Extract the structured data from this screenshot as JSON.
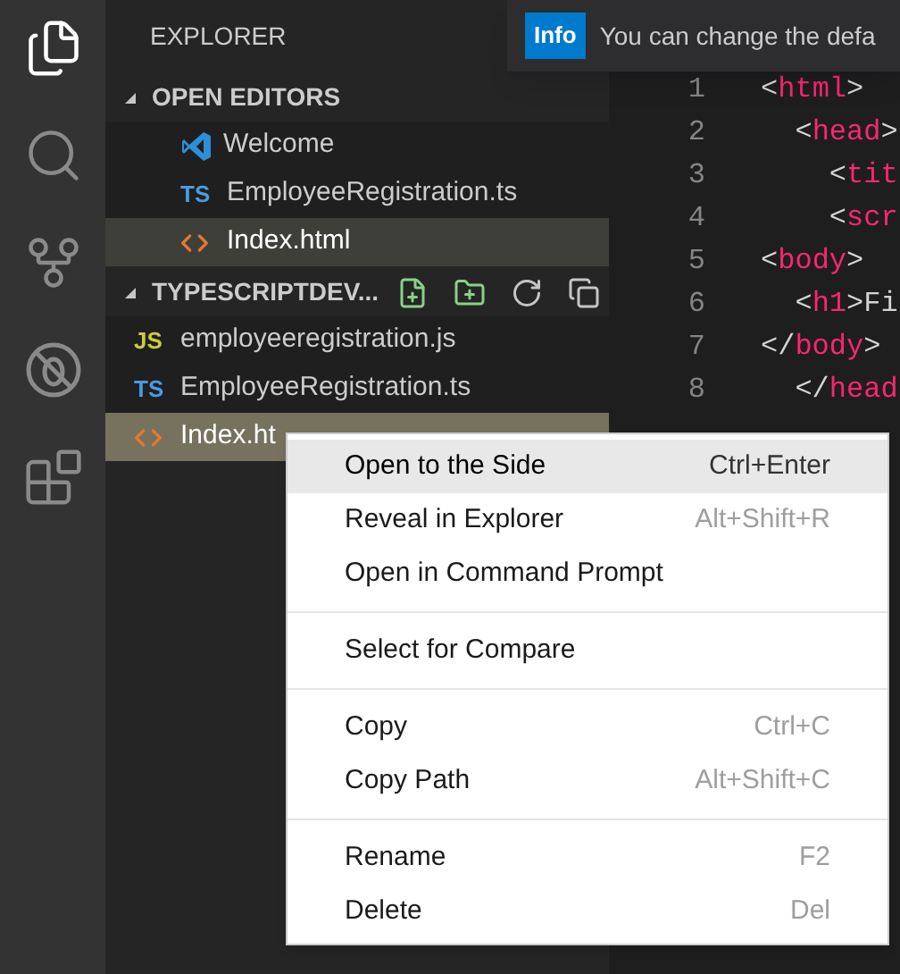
{
  "activity_bar": {
    "items": [
      {
        "kind": "files",
        "selected": true
      },
      {
        "kind": "search",
        "selected": false
      },
      {
        "kind": "git",
        "selected": false
      },
      {
        "kind": "debug",
        "selected": false
      },
      {
        "kind": "extensions",
        "selected": false
      }
    ]
  },
  "sidebar": {
    "title": "EXPLORER",
    "open_editors": {
      "label": "OPEN EDITORS",
      "expanded": true,
      "items": [
        {
          "name": "Welcome",
          "kind": "vscode",
          "selected": false
        },
        {
          "name": "EmployeeRegistration.ts",
          "kind": "ts",
          "badge": "TS",
          "selected": false
        },
        {
          "name": "Index.html",
          "kind": "html",
          "selected": true
        }
      ]
    },
    "folder": {
      "label": "TYPESCRIPTDEV...",
      "expanded": true,
      "items": [
        {
          "name": "employeeregistration.js",
          "kind": "js",
          "badge": "JS",
          "selected": false
        },
        {
          "name": "EmployeeRegistration.ts",
          "kind": "ts",
          "badge": "TS",
          "selected": false
        },
        {
          "name": "Index.ht",
          "kind": "html",
          "selected": true
        }
      ]
    }
  },
  "notification": {
    "badge": "Info",
    "message": "You can change the defa"
  },
  "editor": {
    "lines": [
      {
        "number": "1",
        "tokens": [
          {
            "kind": "punct",
            "text": "<"
          },
          {
            "kind": "tag",
            "text": "html"
          },
          {
            "kind": "punct",
            "text": ">"
          }
        ]
      },
      {
        "number": "2",
        "tokens": [
          {
            "kind": "punct",
            "text": "  <"
          },
          {
            "kind": "tag",
            "text": "head"
          },
          {
            "kind": "punct",
            "text": ">"
          }
        ]
      },
      {
        "number": "3",
        "tokens": [
          {
            "kind": "punct",
            "text": "    <"
          },
          {
            "kind": "tag",
            "text": "tit"
          }
        ]
      },
      {
        "number": "4",
        "tokens": [
          {
            "kind": "punct",
            "text": "    <"
          },
          {
            "kind": "tag",
            "text": "scr"
          }
        ]
      },
      {
        "number": "5",
        "tokens": [
          {
            "kind": "punct",
            "text": "<"
          },
          {
            "kind": "tag",
            "text": "body"
          },
          {
            "kind": "punct",
            "text": ">"
          }
        ]
      },
      {
        "number": "6",
        "tokens": [
          {
            "kind": "punct",
            "text": "  <"
          },
          {
            "kind": "tag",
            "text": "h1"
          },
          {
            "kind": "punct",
            "text": ">"
          },
          {
            "kind": "text",
            "text": "Fi"
          }
        ]
      },
      {
        "number": "7",
        "tokens": [
          {
            "kind": "punct",
            "text": "</"
          },
          {
            "kind": "tag",
            "text": "body"
          },
          {
            "kind": "punct",
            "text": ">"
          }
        ]
      },
      {
        "number": "8",
        "tokens": [
          {
            "kind": "punct",
            "text": "  </"
          },
          {
            "kind": "tag",
            "text": "head"
          }
        ]
      }
    ]
  },
  "context_menu": {
    "groups": [
      [
        {
          "label": "Open to the Side",
          "shortcut": "Ctrl+Enter",
          "selected": true
        },
        {
          "label": "Reveal in Explorer",
          "shortcut": "Alt+Shift+R",
          "selected": false
        },
        {
          "label": "Open in Command Prompt",
          "selected": false
        }
      ],
      [
        {
          "label": "Select for Compare",
          "selected": false
        }
      ],
      [
        {
          "label": "Copy",
          "shortcut": "Ctrl+C",
          "selected": false
        },
        {
          "label": "Copy Path",
          "shortcut": "Alt+Shift+C",
          "selected": false
        }
      ],
      [
        {
          "label": "Rename",
          "shortcut": "F2",
          "selected": false
        },
        {
          "label": "Delete",
          "shortcut": "Del",
          "selected": false
        }
      ]
    ]
  }
}
